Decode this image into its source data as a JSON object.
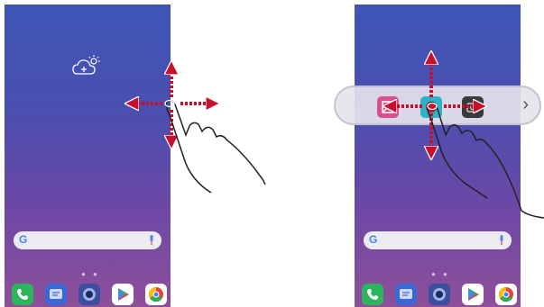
{
  "left_screen": {
    "weather_icon": "cloud-sun-plus-icon",
    "search": {
      "logo": "G",
      "mic_icon": "mic-icon"
    },
    "page_dots": "● ●",
    "dock": [
      {
        "icon": "phone-icon",
        "color": "#2db55d"
      },
      {
        "icon": "messages-icon",
        "color": "#3a69d6"
      },
      {
        "icon": "camera-icon",
        "color": "#3c4e9e"
      },
      {
        "icon": "play-store-icon",
        "color": "#ffffff"
      },
      {
        "icon": "chrome-icon",
        "color": "#ffffff"
      }
    ]
  },
  "right_screen": {
    "search": {
      "logo": "G",
      "mic_icon": "mic-icon"
    },
    "page_dots": "● ●",
    "quick_bar": {
      "items": [
        "screenshot-icon",
        "record-icon",
        "camera-icon"
      ],
      "chevron": "›"
    }
  },
  "colors": {
    "arrow": "#c8102e",
    "gradient_top": "#3d56b6",
    "gradient_bottom": "#8e4f9a"
  }
}
